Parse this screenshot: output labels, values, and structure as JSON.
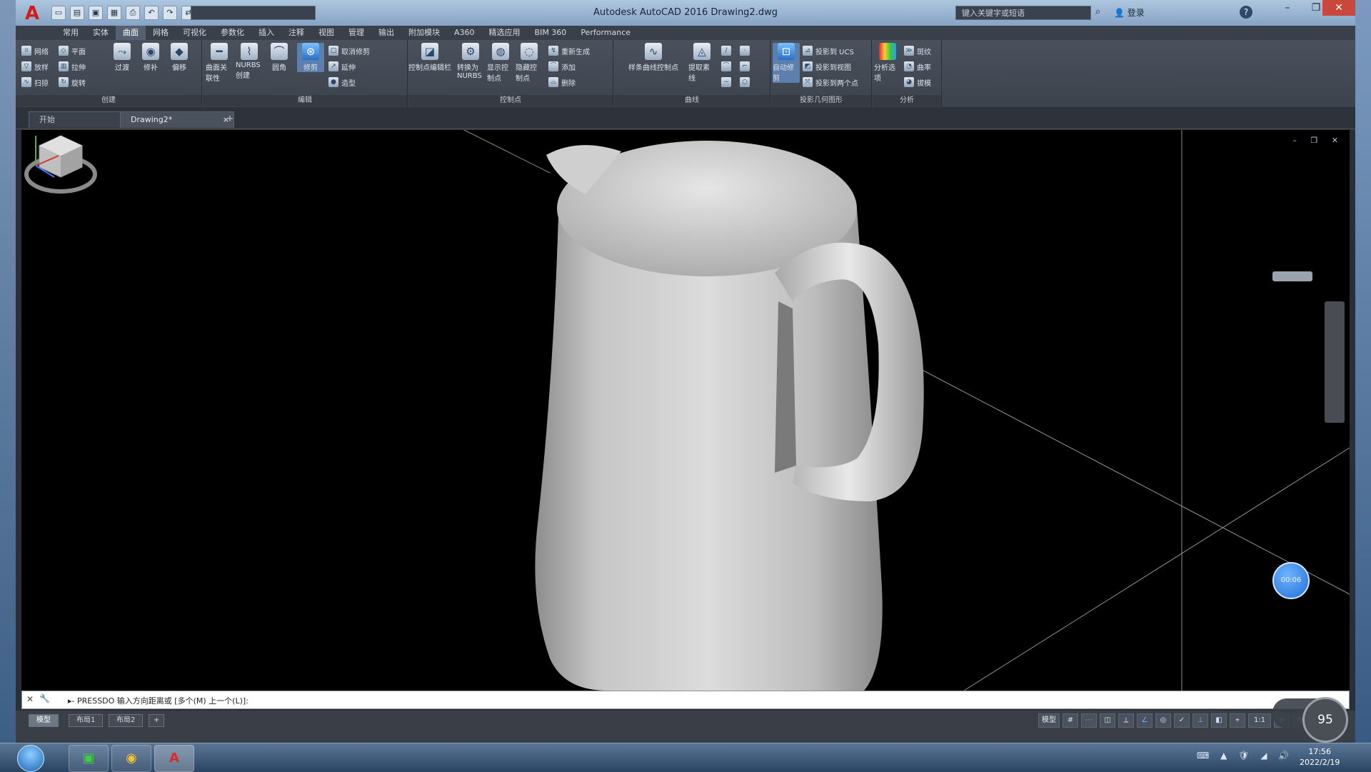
{
  "titlebar": {
    "logo": "A",
    "title": "Autodesk AutoCAD 2016    Drawing2.dwg",
    "workspace": "",
    "search_placeholder": "键入关键字或短语",
    "signin": "登录",
    "help": "?",
    "min": "–",
    "max": "❐",
    "close": "✕"
  },
  "ribbon_tabs": [
    "常用",
    "实体",
    "曲面",
    "网格",
    "可视化",
    "参数化",
    "插入",
    "注释",
    "视图",
    "管理",
    "输出",
    "附加模块",
    "A360",
    "精选应用",
    "BIM 360",
    "Performance"
  ],
  "ribbon_active_tab": "曲面",
  "ribbon": {
    "create_group": {
      "label": "创建",
      "rows": [
        [
          "网络",
          "平面"
        ],
        [
          "放样",
          "拉伸"
        ],
        [
          "扫掠",
          "旋转"
        ]
      ],
      "buttons": [
        "过渡",
        "修补",
        "偏移"
      ]
    },
    "edit_group": {
      "label": "编辑",
      "buttons": [
        "圆角",
        "修剪",
        "延伸"
      ],
      "big_buttons": [
        "曲面关联性",
        "NURBS 创建"
      ],
      "rows": [
        "取消修剪",
        "延伸",
        "造型"
      ]
    },
    "cv_group": {
      "label": "控制点",
      "buttons": [
        "转换为 NURBS",
        "显示控制点",
        "隐藏控制点"
      ],
      "rows": [
        "重新生成",
        "添加",
        "删除"
      ],
      "extra": "控制点编辑栏"
    },
    "curves_group": {
      "label": "曲线",
      "buttons": [
        "样条曲线控制点",
        "提取素线"
      ]
    },
    "project_group": {
      "label": "投影几何图形",
      "buttons": [
        "自动修剪"
      ],
      "rows": [
        "投影到 UCS",
        "投影到视图",
        "投影到两个点"
      ]
    },
    "analysis_group": {
      "label": "分析",
      "buttons": [
        "分析选项"
      ],
      "rows": [
        "斑纹",
        "曲率",
        "拔模"
      ]
    }
  },
  "doc_tabs": [
    "开始",
    "Drawing2*"
  ],
  "doc_tab_close": "×",
  "doc_tab_new": "+",
  "viewport": {
    "controls": "– ❐ ✕",
    "timer": "00:06"
  },
  "command_line": {
    "close": "✕",
    "tool": "🔧",
    "text": "▸- PRESSDO 输入方向距离或 [多个(M) 上一个(L)]:"
  },
  "corner_dial": "95",
  "layout_tabs": [
    "模型",
    "布局1",
    "布局2",
    "+"
  ],
  "status_bar": {
    "model": "模型",
    "scale": "1:1",
    "buttons": [
      "#",
      "⋯",
      "◫",
      "⟂",
      "∠",
      "◎",
      "✓",
      "⊥",
      "◧",
      "⌖",
      "✚",
      "⚙",
      "≡"
    ]
  },
  "taskbar": {
    "apps": [
      "WeChat",
      "Chrome",
      "AutoCAD"
    ],
    "tray": "⌨ ▲ 🛡 ◢ 🔊",
    "time": "17:56",
    "date": "2022/2/19"
  }
}
